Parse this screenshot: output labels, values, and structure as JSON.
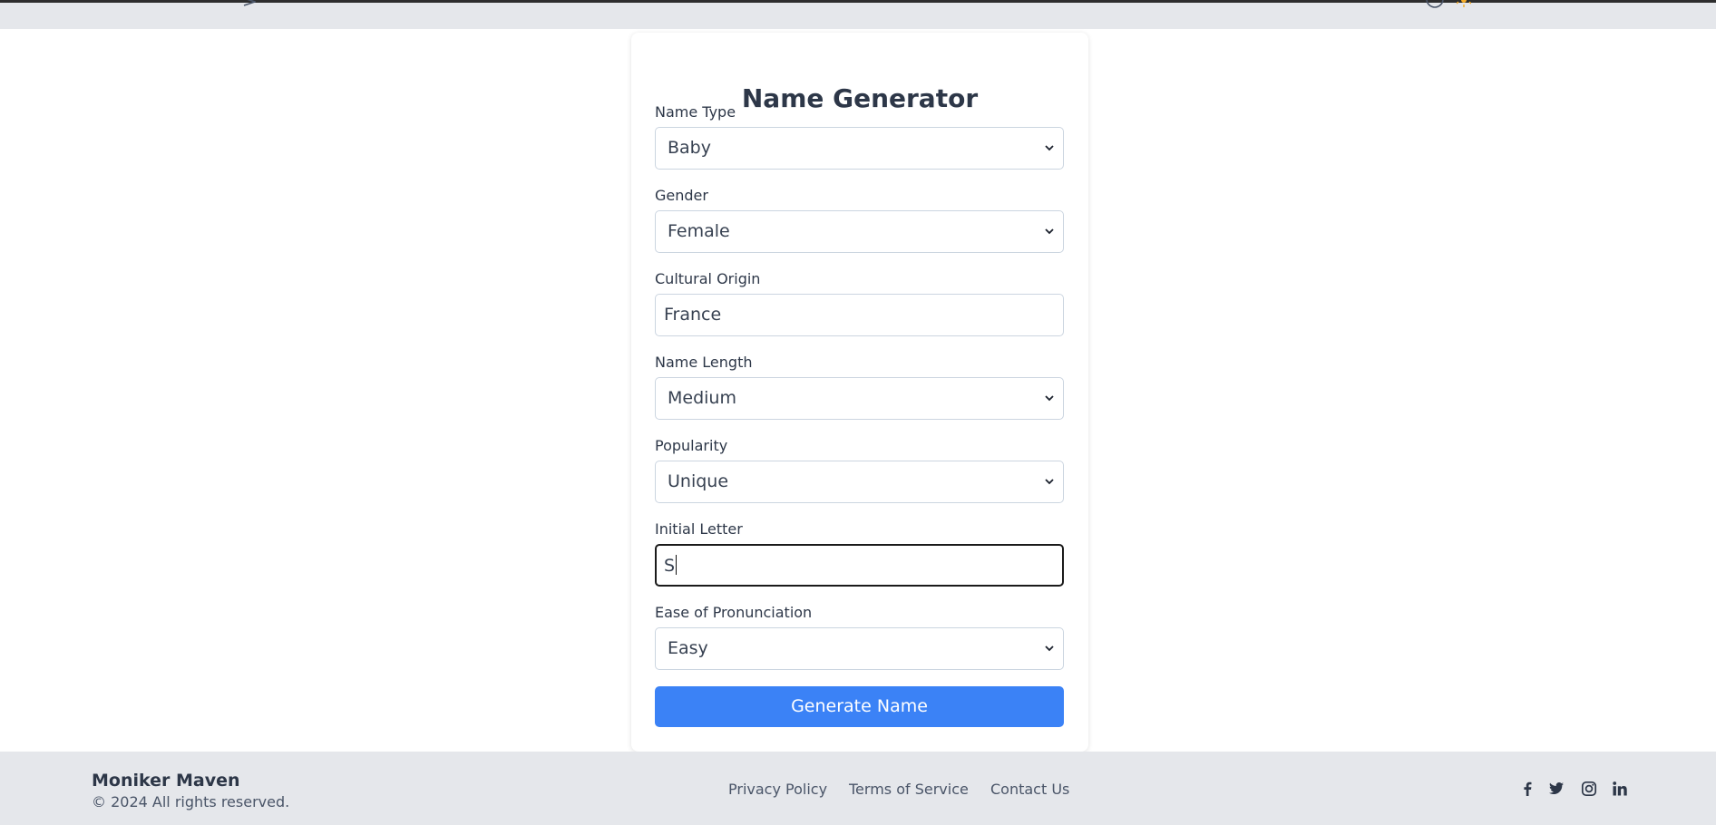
{
  "form": {
    "title": "Name Generator",
    "fields": [
      {
        "label": "Name Type",
        "value": "Baby"
      },
      {
        "label": "Gender",
        "value": "Female"
      },
      {
        "label": "Cultural Origin",
        "value": "France"
      },
      {
        "label": "Name Length",
        "value": "Medium"
      },
      {
        "label": "Popularity",
        "value": "Unique"
      },
      {
        "label": "Initial Letter",
        "value": "S"
      },
      {
        "label": "Ease of Pronunciation",
        "value": "Easy"
      }
    ],
    "submit_label": "Generate Name"
  },
  "footer": {
    "brand": "Moniker Maven",
    "copyright": "© 2024 All rights reserved.",
    "links": [
      "Privacy Policy",
      "Terms of Service",
      "Contact Us"
    ],
    "social_icons": [
      "facebook-icon",
      "twitter-icon",
      "instagram-icon",
      "linkedin-icon"
    ]
  },
  "colors": {
    "accent": "#3b82f6",
    "footer_bg": "#e5e7eb",
    "heading": "#2d3748"
  }
}
